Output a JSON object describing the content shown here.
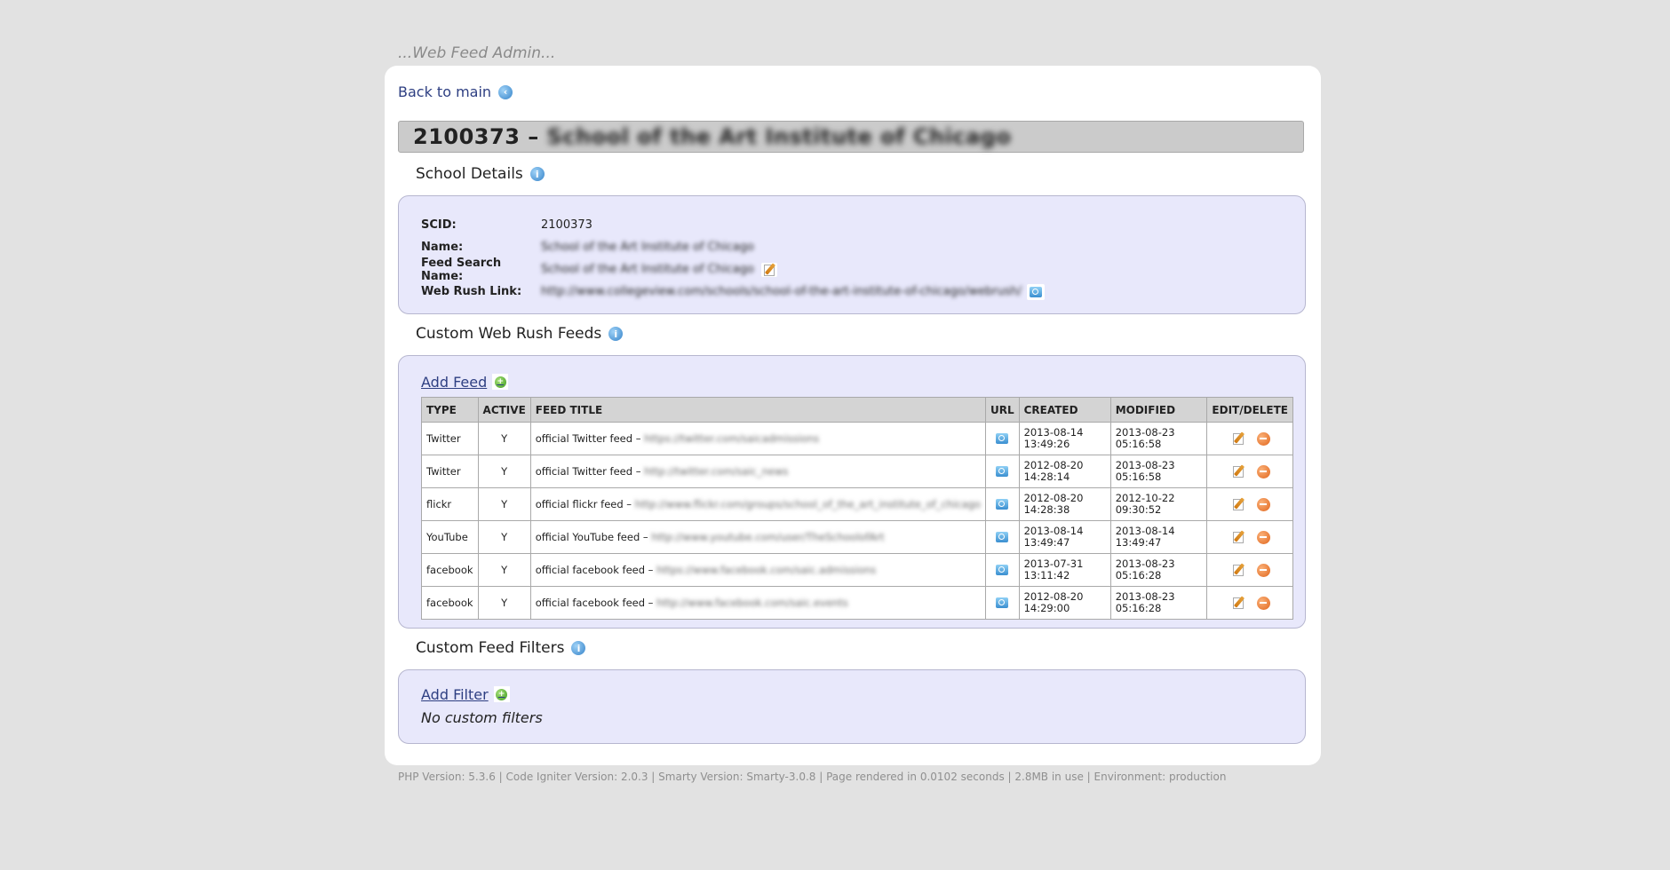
{
  "app_title": "...Web Feed Admin...",
  "back_link": "Back to main",
  "header": {
    "scid": "2100373",
    "separator": " – ",
    "school_name": "School of the Art Institute of Chicago"
  },
  "details": {
    "title": "School Details",
    "rows": [
      {
        "label": "SCID:",
        "value": "2100373"
      },
      {
        "label": "Name:",
        "value": "School of the Art Institute of Chicago"
      },
      {
        "label": "Feed Search Name:",
        "value": "School of the Art Institute of Chicago"
      },
      {
        "label": "Web Rush Link:",
        "value": "http://www.collegeview.com/schools/school-of-the-art-institute-of-chicago/webrush/"
      }
    ]
  },
  "feeds": {
    "title": "Custom Web Rush Feeds",
    "add_label": "Add Feed",
    "columns": [
      "TYPE",
      "ACTIVE",
      "FEED TITLE",
      "URL",
      "CREATED",
      "MODIFIED",
      "EDIT/DELETE"
    ],
    "rows": [
      {
        "type": "Twitter",
        "active": "Y",
        "title": "official Twitter feed – ",
        "url": "https://twitter.com/saicadmissions",
        "created_date": "2013-08-14",
        "created_time": "13:49:26",
        "modified_date": "2013-08-23",
        "modified_time": "05:16:58"
      },
      {
        "type": "Twitter",
        "active": "Y",
        "title": "official Twitter feed – ",
        "url": "http://twitter.com/saic_news",
        "created_date": "2012-08-20",
        "created_time": "14:28:14",
        "modified_date": "2013-08-23",
        "modified_time": "05:16:58"
      },
      {
        "type": "flickr",
        "active": "Y",
        "title": "official flickr feed – ",
        "url": "http://www.flickr.com/groups/school_of_the_art_institute_of_chicago",
        "created_date": "2012-08-20",
        "created_time": "14:28:38",
        "modified_date": "2012-10-22",
        "modified_time": "09:30:52"
      },
      {
        "type": "YouTube",
        "active": "Y",
        "title": "official YouTube feed – ",
        "url": "http://www.youtube.com/user/TheSchoolofArt",
        "created_date": "2013-08-14",
        "created_time": "13:49:47",
        "modified_date": "2013-08-14",
        "modified_time": "13:49:47"
      },
      {
        "type": "facebook",
        "active": "Y",
        "title": "official facebook feed – ",
        "url": "https://www.facebook.com/saic.admissions",
        "created_date": "2013-07-31",
        "created_time": "13:11:42",
        "modified_date": "2013-08-23",
        "modified_time": "05:16:28"
      },
      {
        "type": "facebook",
        "active": "Y",
        "title": "official facebook feed – ",
        "url": "http://www.facebook.com/saic.events",
        "created_date": "2012-08-20",
        "created_time": "14:29:00",
        "modified_date": "2013-08-23",
        "modified_time": "05:16:28"
      }
    ]
  },
  "filters": {
    "title": "Custom Feed Filters",
    "add_label": "Add Filter",
    "empty_text": "No custom filters"
  },
  "footer": "PHP Version: 5.3.6 | Code Igniter Version: 2.0.3 | Smarty Version: Smarty-3.0.8 | Page rendered in 0.0102 seconds | 2.8MB in use | Environment: production"
}
